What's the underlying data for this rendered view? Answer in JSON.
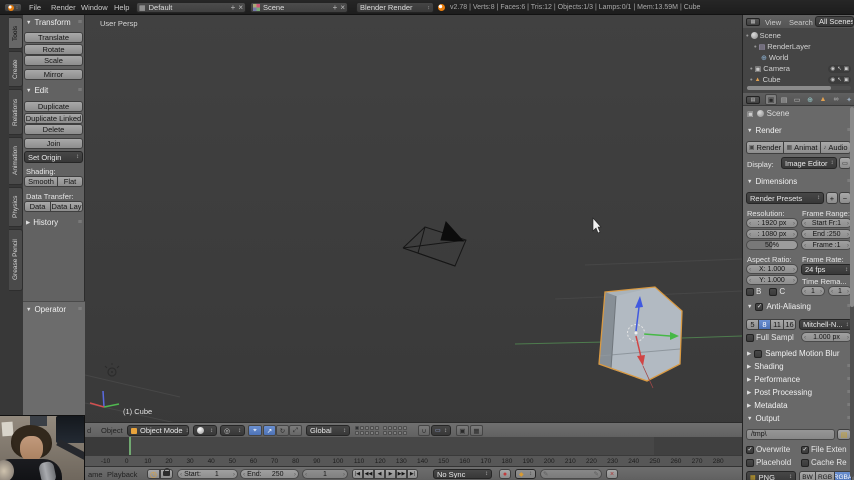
{
  "icons": {
    "down_tri": "▼",
    "right_tri": "▶",
    "updown": "↕",
    "check": "✓",
    "chl": "‹",
    "chr": "›",
    "plus": "+",
    "minus": "−",
    "close": "×",
    "grip": "≡",
    "grid": "▦",
    "clock": "◷",
    "record": "●",
    "key_diamond": "◆",
    "eye": "◉",
    "pointer": "↖",
    "cam": "▣",
    "sphere": "●",
    "pivot": "◎",
    "magnet": "∪",
    "pen": "✎",
    "folder": "▤",
    "note": "♪",
    "scene_dot": "•",
    "world": "⊕",
    "mesh_tri": "▲",
    "layers": "▤",
    "wrench": "✦",
    "data_tri": "▽",
    "infinity": "∞",
    "box": "▭",
    "photo": "▦",
    "jump_start": "|◀",
    "prev_key": "◀◀",
    "play_rev": "◀",
    "play": "▶",
    "next_key": "▶▶",
    "jump_end": "▶|"
  },
  "topbar": {
    "menus": [
      "File",
      "Render",
      "Window",
      "Help"
    ],
    "layout_selector": "Default",
    "scene_selector": "Scene",
    "engine_selector": "Blender Render",
    "stats": "v2.78 | Verts:8 | Faces:6 | Tris:12 | Objects:1/3 | Lamps:0/1 | Mem:13.59M | Cube"
  },
  "toolshelf": {
    "tabs": [
      "Tools",
      "Create",
      "Relations",
      "Animation",
      "Physics",
      "Grease Pencil"
    ],
    "transform_title": "Transform",
    "transform_buttons": [
      "Translate",
      "Rotate",
      "Scale",
      "Mirror"
    ],
    "edit_title": "Edit",
    "edit_buttons": [
      "Duplicate",
      "Duplicate Linked",
      "Delete",
      "Join"
    ],
    "set_origin": "Set Origin",
    "shading_label": "Shading:",
    "smooth": "Smooth",
    "flat": "Flat",
    "data_transfer_label": "Data Transfer:",
    "data_btn": "Data",
    "data_lay_btn": "Data Lay",
    "history_title": "History",
    "operator_title": "Operator"
  },
  "viewport": {
    "persp_label": "User Persp",
    "object_name": "(1) Cube",
    "header": {
      "menu_partial": "d",
      "object_menu": "Object",
      "mode": "Object Mode",
      "orientation": "Global"
    }
  },
  "timeline": {
    "ticks": [
      "-10",
      "0",
      "10",
      "20",
      "30",
      "40",
      "50",
      "60",
      "70",
      "80",
      "90",
      "100",
      "110",
      "120",
      "130",
      "140",
      "150",
      "160",
      "170",
      "180",
      "190",
      "200",
      "210",
      "220",
      "230",
      "240",
      "250",
      "260",
      "270",
      "280"
    ],
    "frame_menu_partial": "ame",
    "playback_menu": "Playback",
    "start_label": "Start:",
    "start_value": "1",
    "end_label": "End:",
    "end_value": "250",
    "current_frame": "1",
    "sync": "No Sync"
  },
  "outliner": {
    "view_menu": "View",
    "search_menu": "Search",
    "display_filter": "All Scenes",
    "items": [
      "Scene",
      "RenderLayer",
      "World",
      "Camera",
      "Cube"
    ]
  },
  "properties": {
    "breadcrumb": "Scene",
    "render_title": "Render",
    "render_buttons": [
      "Render",
      "Animat",
      "Audio"
    ],
    "display_label": "Display:",
    "display_value": "Image Editor",
    "dimensions_title": "Dimensions",
    "presets": "Render Presets",
    "resolution_label": "Resolution:",
    "frame_range_label": "Frame Range:",
    "res_x": ": 1920 px",
    "res_y": ": 1080 px",
    "res_pct": "50%",
    "fr_start": "Start Fr:1",
    "fr_end": "End :250",
    "fr_step": "Frame :1",
    "aspect_label": "Aspect Ratio:",
    "rate_label": "Frame Rate:",
    "asp_x": "X: 1.000",
    "asp_y": "Y: 1.000",
    "fps": "24 fps",
    "remap_label": "Time Rema...",
    "border_label": "B",
    "crop_label": "C",
    "remap_old": "1",
    "remap_new": "1",
    "aa_title": "Anti-Aliasing",
    "aa_samples": [
      "5",
      "8",
      "11",
      "16"
    ],
    "aa_filter": "Mitchell-N...",
    "full_sample": "Full Sampl",
    "aa_size": "1.000 px",
    "motion_blur_title": "Sampled Motion Blur",
    "collapsed": [
      "Shading",
      "Performance",
      "Post Processing",
      "Metadata"
    ],
    "output_title": "Output",
    "output_path": "/tmp\\",
    "overwrite": "Overwrite",
    "file_ext": "File Exten",
    "placeholder": "Placehold",
    "cache": "Cache Re",
    "format": "PNG",
    "color_modes": [
      "BW",
      "RGB",
      "RGBA"
    ]
  }
}
